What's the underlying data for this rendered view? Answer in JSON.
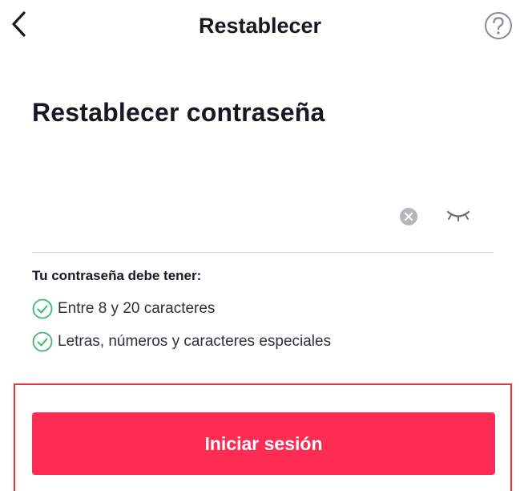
{
  "header": {
    "title": "Restablecer",
    "back_icon": "chevron-left-icon",
    "help_icon": "question-circle-icon"
  },
  "page_title": "Restablecer contraseña",
  "password_field": {
    "value": "",
    "placeholder": "",
    "clear_icon": "clear-circle-icon",
    "visibility_icon": "eye-closed-icon"
  },
  "requirements": {
    "heading": "Tu contraseña debe tener:",
    "items": [
      {
        "label": "Entre 8 y 20 caracteres",
        "icon": "check-circle-icon",
        "met": true
      },
      {
        "label": "Letras, números y caracteres especiales",
        "icon": "check-circle-icon",
        "met": true
      }
    ]
  },
  "primary_button": {
    "label": "Iniciar sesión"
  },
  "colors": {
    "accent": "#fe2c55",
    "check": "#3bbb6a",
    "highlight_border": "#e8323c",
    "text": "#161823"
  }
}
